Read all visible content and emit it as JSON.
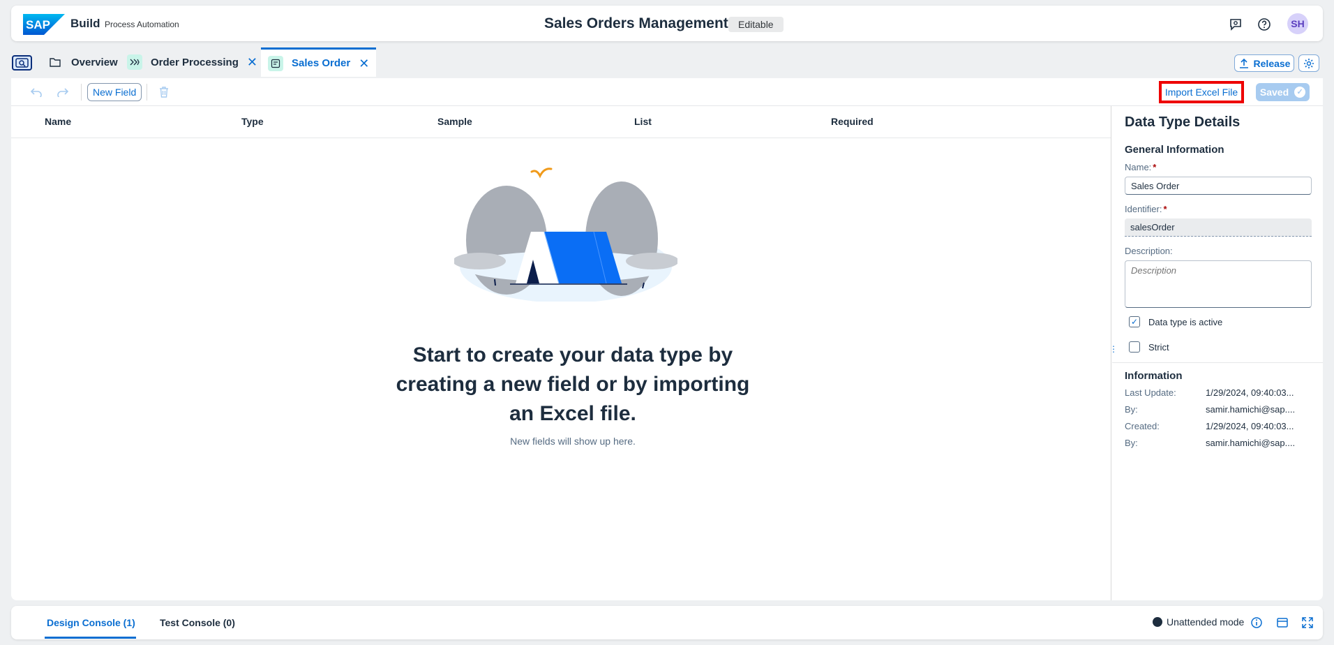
{
  "shell": {
    "logo_text": "SAP",
    "brand": "Build",
    "brand_sub": "Process Automation",
    "title": "Sales Orders Management",
    "status_badge": "Editable",
    "avatar_initials": "SH",
    "icons": [
      "feedback-icon",
      "help-icon"
    ]
  },
  "tabs": [
    {
      "label": "Overview",
      "icon": "folder-icon",
      "closable": false
    },
    {
      "label": "Order Processing",
      "icon": "process-icon",
      "closable": true
    },
    {
      "label": "Sales Order",
      "icon": "data-type-icon",
      "closable": true,
      "active": true
    }
  ],
  "tab_actions": {
    "release_label": "Release"
  },
  "toolbar": {
    "new_field_label": "New Field",
    "import_label": "Import Excel File",
    "saved_label": "Saved"
  },
  "table": {
    "columns": [
      "Name",
      "Type",
      "Sample",
      "List",
      "Required"
    ]
  },
  "empty_state": {
    "title": "Start to create your data type by creating a new field or by importing an Excel file.",
    "subtitle": "New fields will show up here."
  },
  "details": {
    "title": "Data Type Details",
    "general_heading": "General Information",
    "name_label": "Name:",
    "name_value": "Sales Order",
    "identifier_label": "Identifier:",
    "identifier_value": "salesOrder",
    "description_label": "Description:",
    "description_placeholder": "Description",
    "active_label": "Data type is active",
    "active_checked": true,
    "strict_label": "Strict",
    "strict_checked": false,
    "info_heading": "Information",
    "info": [
      {
        "key": "Last Update:",
        "value": "1/29/2024, 09:40:03..."
      },
      {
        "key": "By:",
        "value": "samir.hamichi@sap...."
      },
      {
        "key": "Created:",
        "value": "1/29/2024, 09:40:03..."
      },
      {
        "key": "By:",
        "value": "samir.hamichi@sap...."
      }
    ]
  },
  "console": {
    "tabs": [
      "Design Console (1)",
      "Test Console (0)"
    ],
    "mode_label": "Unattended mode"
  },
  "colors": {
    "accent": "#0a6ed1",
    "highlight_border": "#ee0000",
    "background": "#eef0f2"
  }
}
